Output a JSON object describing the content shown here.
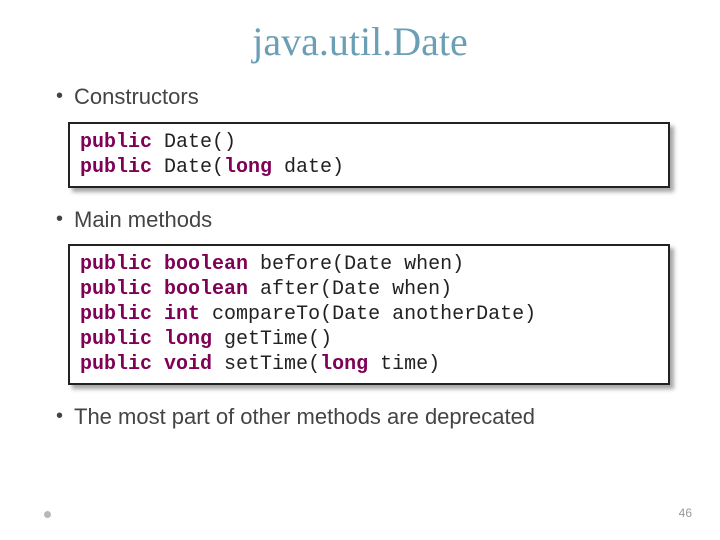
{
  "title": "java.util.Date",
  "bullets": {
    "b1": "Constructors",
    "b2": "Main methods",
    "b3": "The most part of other methods are deprecated"
  },
  "code1": {
    "kw_public1": "public",
    "sig1": " Date()",
    "kw_public2": "public",
    "sig2a": " Date(",
    "kw_long": "long",
    "sig2b": " date)"
  },
  "code2": {
    "l1_kw1": "public",
    "l1_kw2": "boolean",
    "l1_rest": " before(Date when)",
    "l2_kw1": "public",
    "l2_kw2": "boolean",
    "l2_rest": " after(Date when)",
    "l3_kw1": "public",
    "l3_kw2": "int",
    "l3_rest": " compareTo(Date anotherDate)",
    "l4_kw1": "public",
    "l4_kw2": "long",
    "l4_rest": " getTime()",
    "l5_kw1": "public",
    "l5_kw2": "void",
    "l5_rest_a": " setTime(",
    "l5_kw3": "long",
    "l5_rest_b": " time)"
  },
  "page_number": "46"
}
